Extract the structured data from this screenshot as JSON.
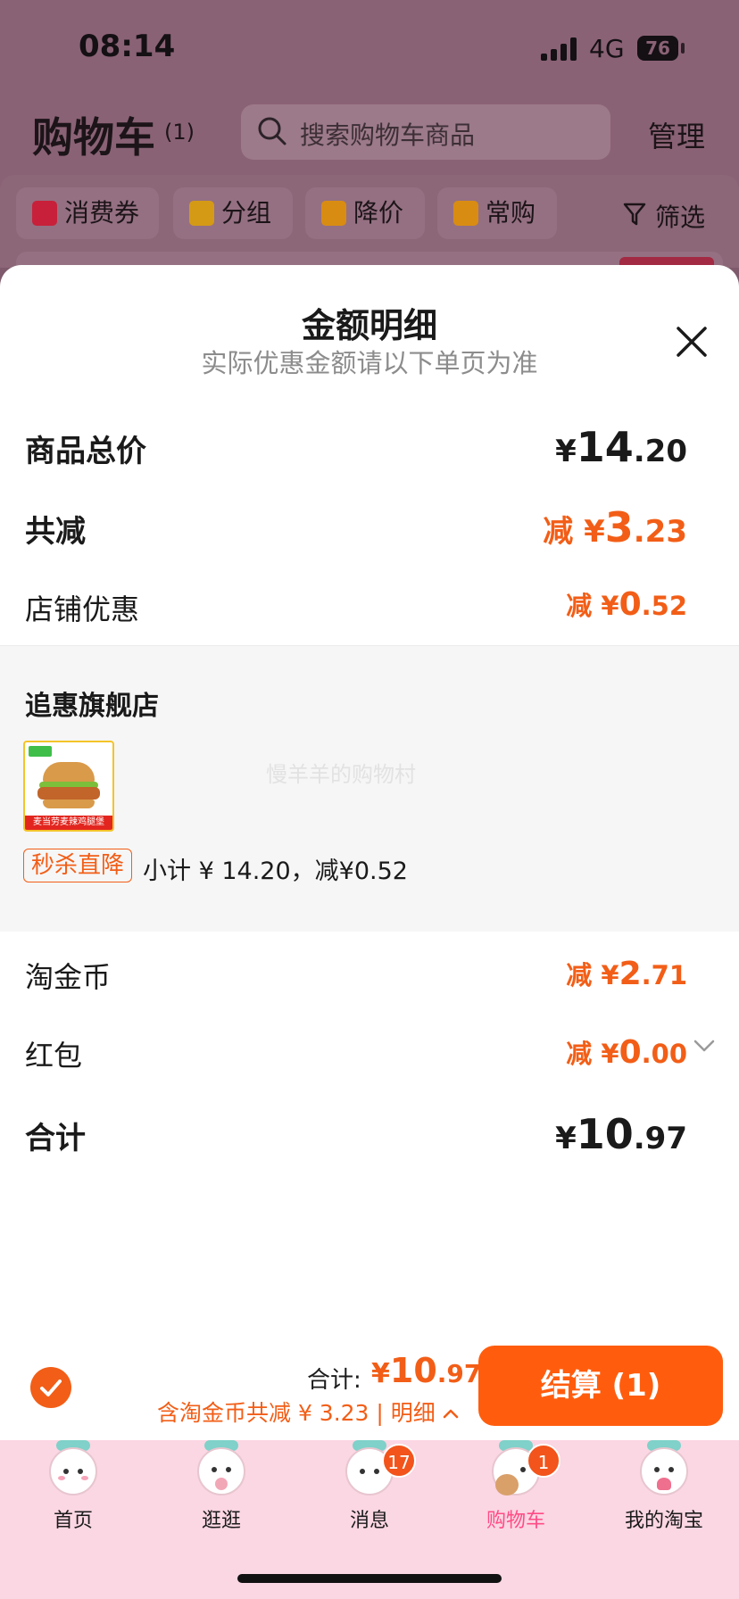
{
  "status_bar": {
    "time": "08:14",
    "network": "4G",
    "battery": "76"
  },
  "cart_header": {
    "title": "购物车",
    "count": "(1)",
    "search_placeholder": "搜索购物车商品",
    "manage": "管理"
  },
  "cart_toolbar": {
    "chips": [
      {
        "label": "消费券",
        "icon": "coupon-icon"
      },
      {
        "label": "分组",
        "icon": "folder-icon"
      },
      {
        "label": "降价",
        "icon": "price-drop-icon"
      },
      {
        "label": "常购",
        "icon": "cart-icon"
      }
    ],
    "filter": "筛选"
  },
  "sheet": {
    "title": "金额明细",
    "subtitle": "实际优惠金额请以下单页为准",
    "rows": {
      "goods_total": {
        "label": "商品总价",
        "currency": "¥",
        "int": "14",
        "dec": ".20"
      },
      "total_reduction": {
        "label": "共减",
        "prefix": "减 ¥",
        "int": "3",
        "dec": ".23"
      },
      "store_discount": {
        "label": "店铺优惠",
        "prefix": "减 ¥",
        "int": "0",
        "dec": ".52"
      }
    },
    "store": {
      "name": "追惠旗舰店",
      "watermark": "慢羊羊的购物村",
      "product_image_caption": "麦当劳麦辣鸡腿堡",
      "tag": "秒杀直降",
      "subtotal": "小计 ¥ 14.20，减¥0.52"
    },
    "rows2": {
      "taojin": {
        "label": "淘金币",
        "prefix": "减 ¥",
        "int": "2",
        "dec": ".71"
      },
      "hongbao": {
        "label": "红包",
        "prefix": "减 ¥",
        "int": "0",
        "dec": ".00"
      },
      "total": {
        "label": "合计",
        "currency": "¥",
        "int": "10",
        "dec": ".97"
      }
    }
  },
  "checkout": {
    "total_label": "合计:",
    "total_currency": "¥",
    "total_int": "10",
    "total_dec": ".97",
    "discount_note": "含淘金币共减 ¥ 3.23 | 明细",
    "pay_button": "结算 (1)"
  },
  "tabbar": {
    "tabs": [
      {
        "label": "首页",
        "badge": ""
      },
      {
        "label": "逛逛",
        "badge": ""
      },
      {
        "label": "消息",
        "badge": "17"
      },
      {
        "label": "购物车",
        "badge": "1"
      },
      {
        "label": "我的淘宝",
        "badge": ""
      }
    ]
  },
  "colors": {
    "accent": "#f25e17",
    "pay_button": "#ff5d0d",
    "tab_active": "#ff4c86",
    "tabbar_bg": "#fbd6e3"
  }
}
